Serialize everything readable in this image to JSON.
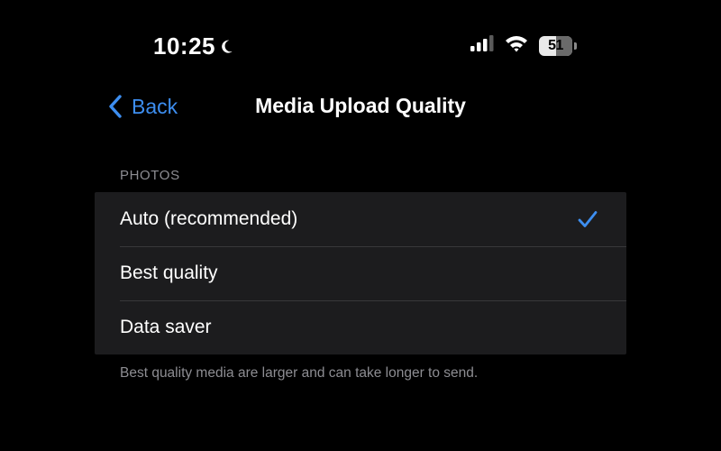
{
  "status_bar": {
    "time": "10:25",
    "battery_level": "51",
    "battery_fraction": 0.51,
    "icons": [
      "moon-icon",
      "cellular-signal-icon",
      "wifi-icon",
      "battery-icon"
    ]
  },
  "nav": {
    "back_label": "Back",
    "title": "Media Upload Quality"
  },
  "section": {
    "header": "PHOTOS",
    "options": [
      {
        "label": "Auto (recommended)",
        "selected": true
      },
      {
        "label": "Best quality",
        "selected": false
      },
      {
        "label": "Data saver",
        "selected": false
      }
    ],
    "footer": "Best quality media are larger and can take longer to send."
  },
  "colors": {
    "background": "#000000",
    "cell_background": "#1c1c1e",
    "accent": "#3d8ef0",
    "secondary_text": "#8d8d92",
    "separator": "#38383a"
  }
}
